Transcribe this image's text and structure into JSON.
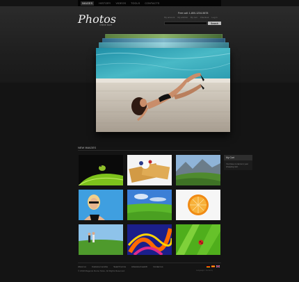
{
  "nav": {
    "items": [
      {
        "label": "Images",
        "active": true
      },
      {
        "label": "History",
        "active": false
      },
      {
        "label": "Videos",
        "active": false
      },
      {
        "label": "Tools",
        "active": false
      },
      {
        "label": "Contacts",
        "active": false
      }
    ]
  },
  "header": {
    "logo": "Photos",
    "tagline": "Online store",
    "free_call": "Free call: 1-800-1234-5678",
    "links": [
      "My account",
      "My wishlist",
      "My cart",
      "Checkout",
      "Log in"
    ],
    "search_placeholder": "",
    "search_button": "Search"
  },
  "section": {
    "new_images_title": "New Images"
  },
  "cart": {
    "title": "My Cart",
    "text": "You have no items in your shopping cart."
  },
  "footer": {
    "links": [
      "About us",
      "Customer service",
      "Search terms",
      "Advanced search",
      "Contact us"
    ],
    "copyright": "© 2010 Magento Demo Store. All Rights Reserved.",
    "currency_label": "Language / Currency"
  },
  "colors": {
    "background": "#141414",
    "accent_light": "#e0e0e0",
    "pool_blue": "#3aa6b6"
  },
  "icons": [
    "flag-de-icon",
    "flag-es-icon",
    "flag-uk-icon"
  ]
}
